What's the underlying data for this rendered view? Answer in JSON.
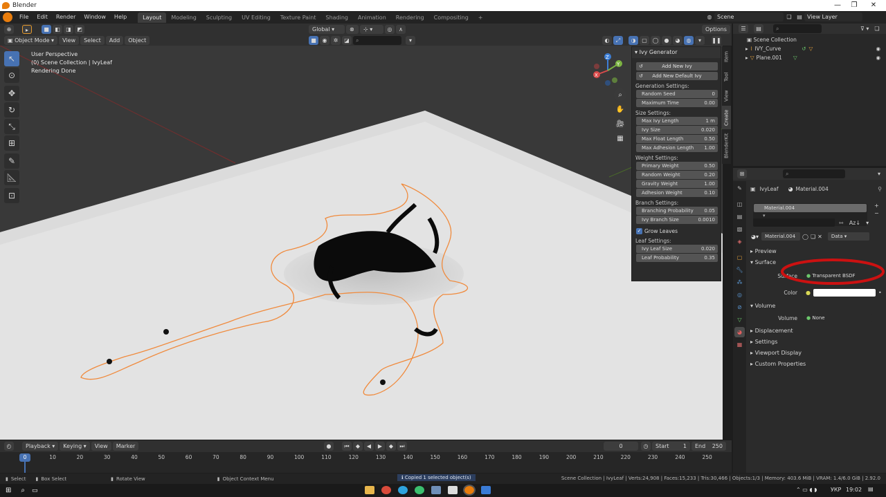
{
  "window": {
    "title": "Blender",
    "minimize": "—",
    "maximize": "❐",
    "close": "✕"
  },
  "menu": {
    "items": [
      "File",
      "Edit",
      "Render",
      "Window",
      "Help"
    ]
  },
  "workspaces": [
    "Layout",
    "Modeling",
    "Sculpting",
    "UV Editing",
    "Texture Paint",
    "Shading",
    "Animation",
    "Rendering",
    "Compositing",
    "+"
  ],
  "top_right": {
    "scene": "Scene",
    "view_layer": "View Layer"
  },
  "viewport_header": {
    "orientation": "Global",
    "options": "Options",
    "mode": "Object Mode",
    "menus": [
      "View",
      "Select",
      "Add",
      "Object"
    ]
  },
  "viewport_info": {
    "line1": "User Perspective",
    "line2": "(0) Scene Collection | IvyLeaf",
    "line3": "Rendering Done"
  },
  "tools": [
    "select-cursor-icon",
    "cursor-icon",
    "move-icon",
    "rotate-icon",
    "scale-icon",
    "transform-icon",
    "annotate-icon",
    "measure-icon",
    "add-cube-icon"
  ],
  "gizmo": {
    "z": "Z",
    "y": "Y",
    "x": "X"
  },
  "ivy_panel": {
    "title": "Ivy Generator",
    "add_new": "Add New Ivy",
    "add_default": "Add New Default Ivy",
    "sections": [
      {
        "title": "Generation Settings:",
        "fields": [
          {
            "label": "Random Seed",
            "value": "0"
          },
          {
            "label": "Maximum Time",
            "value": "0.00"
          }
        ]
      },
      {
        "title": "Size Settings:",
        "fields": [
          {
            "label": "Max Ivy Length",
            "value": "1 m"
          },
          {
            "label": "Ivy Size",
            "value": "0.020"
          },
          {
            "label": "Max Float Length",
            "value": "0.50"
          },
          {
            "label": "Max Adhesion Length",
            "value": "1.00"
          }
        ]
      },
      {
        "title": "Weight Settings:",
        "fields": [
          {
            "label": "Primary Weight",
            "value": "0.50"
          },
          {
            "label": "Random Weight",
            "value": "0.20"
          },
          {
            "label": "Gravity Weight",
            "value": "1.00"
          },
          {
            "label": "Adhesion Weight",
            "value": "0.10"
          }
        ]
      },
      {
        "title": "Branch Settings:",
        "fields": [
          {
            "label": "Branching Probability",
            "value": "0.05"
          },
          {
            "label": "Ivy Branch Size",
            "value": "0.0010"
          }
        ]
      }
    ],
    "grow_leaves": "Grow Leaves",
    "leaf_section": {
      "title": "Leaf Settings:",
      "fields": [
        {
          "label": "Ivy Leaf Size",
          "value": "0.020"
        },
        {
          "label": "Leaf Probability",
          "value": "0.35"
        }
      ]
    }
  },
  "side_tabs": [
    "Item",
    "Tool",
    "View",
    "Create",
    "BlenderKit"
  ],
  "outliner": {
    "root": "Scene Collection",
    "items": [
      {
        "name": "IVY_Curve"
      },
      {
        "name": "Plane.001"
      }
    ]
  },
  "properties": {
    "object": "IvyLeaf",
    "material": "Material.004",
    "slot": "Material.004",
    "material_field": "Material.004",
    "link": "Data",
    "panels": {
      "preview": "Preview",
      "surface": "Surface",
      "surface_label": "Surface",
      "surface_value": "Transparent BSDF",
      "color_label": "Color",
      "volume": "Volume",
      "volume_label": "Volume",
      "volume_value": "None",
      "displacement": "Displacement",
      "settings": "Settings",
      "viewport_display": "Viewport Display",
      "custom_properties": "Custom Properties"
    }
  },
  "timeline": {
    "menus": [
      "Playback",
      "Keying",
      "View",
      "Marker"
    ],
    "current_frame": "0",
    "start_label": "Start",
    "start": "1",
    "end_label": "End",
    "end": "250",
    "ticks": [
      "0",
      "10",
      "20",
      "30",
      "40",
      "50",
      "60",
      "70",
      "80",
      "90",
      "100",
      "110",
      "120",
      "130",
      "140",
      "150",
      "160",
      "170",
      "180",
      "190",
      "200",
      "210",
      "220",
      "230",
      "240",
      "250"
    ]
  },
  "statusbar": {
    "select": "Select",
    "box_select": "Box Select",
    "rotate_view": "Rotate View",
    "context_menu": "Object Context Menu",
    "message": "Copied 1 selected object(s)",
    "stats": "Scene Collection | IvyLeaf | Verts:24,908 | Faces:15,233 | Tris:30,466 | Objects:1/3 | Memory: 403.6 MiB | VRAM: 1.4/6.0 GiB | 2.92.0"
  },
  "taskbar": {
    "lang": "УКР",
    "time": "19:02"
  },
  "colors": {
    "accent": "#4772b3",
    "selection_outline": "#f08a3c",
    "annotation": "#cc1111",
    "window_bg": "#1d1d1d"
  }
}
